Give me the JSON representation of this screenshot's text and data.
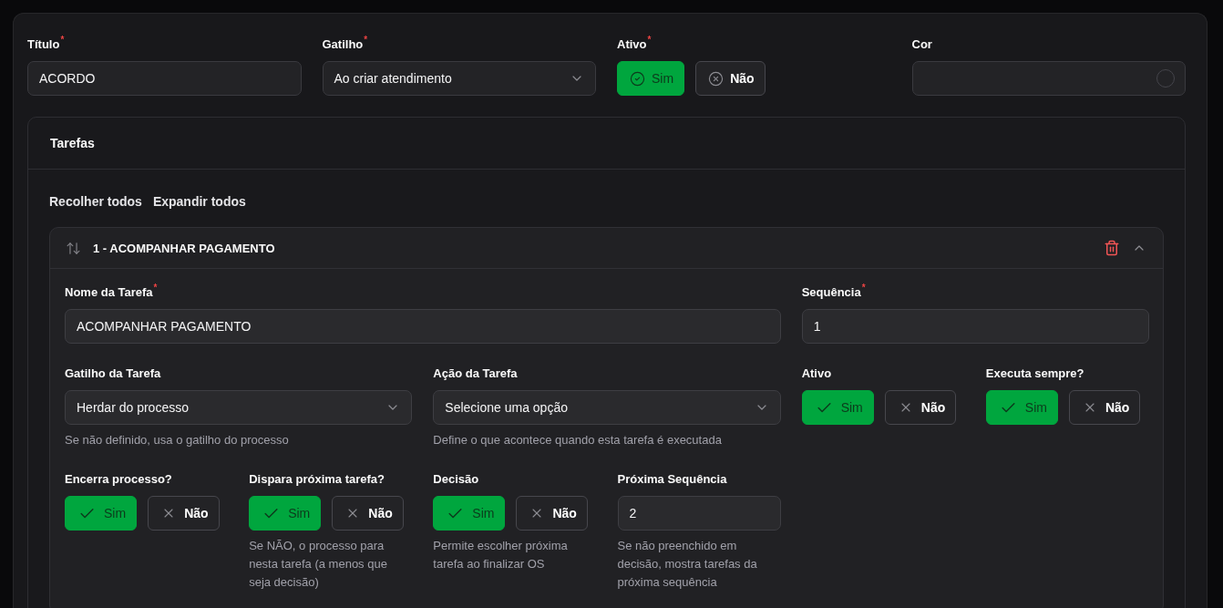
{
  "form": {
    "fields": [
      {
        "kind": "text",
        "label": "Título$^{*}$",
        "value": "ACORDO"
      },
      {
        "kind": "select",
        "label": "Gatilho$^{*}$",
        "value": "Ao criar atendimento"
      },
      {
        "kind": "toggle",
        "label": "Ativo$^{*}$",
        "options": [
          {
            "kind": "yes",
            "label": "Sim",
            "selected": true
          },
          {
            "kind": "no",
            "label": "Não",
            "selected": false
          }
        ]
      },
      {
        "kind": "color",
        "label": "Cor"
      }
    ]
  },
  "tasks_section": {
    "title": "Tarefas",
    "actions": [
      "Recolher todos",
      "Expandir todos"
    ],
    "tasks": [
      {
        "title": "1 - ACOMPANHAR PAGAMENTO",
        "expanded": true,
        "rows": [
          {
            "fields": [
              {
                "kind": "text",
                "label": "Nome da Tarefa$^{*}$",
                "value": "ACOMPANHAR PAGAMENTO"
              },
              {
                "kind": "text",
                "label": "Sequência$^{*}$",
                "value": "1"
              }
            ]
          },
          {
            "fields": [
              {
                "kind": "select",
                "label": "Gatilho da Tarefa",
                "value": "Herdar do processo",
                "hint": "Se não definido, usa o gatilho do processo"
              },
              {
                "kind": "select",
                "label": "Ação da Tarefa",
                "value": "Selecione uma opção",
                "hint": "Define o que acontece quando esta tarefa é executada"
              },
              {
                "kind": "toggle",
                "label": "Ativo",
                "options": [
                  {
                    "kind": "yes",
                    "label": "Sim",
                    "selected": true
                  },
                  {
                    "kind": "no",
                    "label": "Não",
                    "selected": false
                  }
                ]
              },
              {
                "kind": "toggle",
                "label": "Executa sempre?",
                "options": [
                  {
                    "kind": "yes",
                    "label": "Sim",
                    "selected": true
                  },
                  {
                    "kind": "no",
                    "label": "Não",
                    "selected": false
                  }
                ]
              }
            ]
          },
          {
            "fields": [
              {
                "kind": "toggle",
                "label": "Encerra processo?",
                "options": [
                  {
                    "kind": "yes",
                    "label": "Sim",
                    "selected": true
                  },
                  {
                    "kind": "no",
                    "label": "Não",
                    "selected": false
                  }
                ]
              },
              {
                "kind": "toggle",
                "label": "Dispara próxima tarefa?",
                "options": [
                  {
                    "kind": "yes",
                    "label": "Sim",
                    "selected": true
                  },
                  {
                    "kind": "no",
                    "label": "Não",
                    "selected": false
                  }
                ],
                "hint": "Se NÃO, o processo para nesta tarefa (a menos que seja decisão)"
              },
              {
                "kind": "toggle",
                "label": "Decisão",
                "options": [
                  {
                    "kind": "yes",
                    "label": "Sim",
                    "selected": true
                  },
                  {
                    "kind": "no",
                    "label": "Não",
                    "selected": false
                  }
                ],
                "hint": "Permite escolher próxima tarefa ao finalizar OS"
              },
              {
                "kind": "text",
                "label": "Próxima Sequência",
                "value": "2",
                "hint": "Se não preenchido em decisão, mostra tarefas da próxima sequência"
              }
            ]
          }
        ]
      }
    ]
  }
}
